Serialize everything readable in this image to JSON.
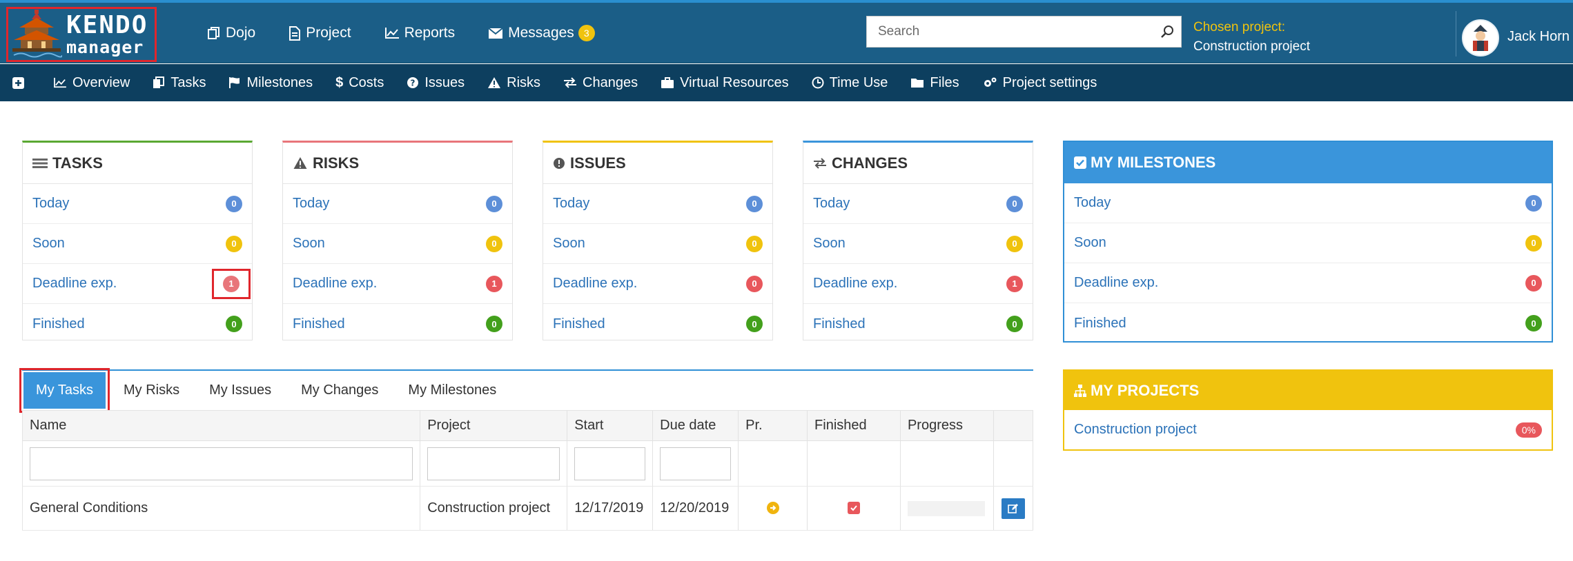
{
  "logo": {
    "line1": "KENDO",
    "line2": "manager"
  },
  "topnav": {
    "dojo": "Dojo",
    "project": "Project",
    "reports": "Reports",
    "messages": "Messages",
    "messages_count": "3"
  },
  "search": {
    "placeholder": "Search"
  },
  "chosen_project": {
    "label": "Chosen project:",
    "value": "Construction project"
  },
  "user": {
    "name": "Jack Horn"
  },
  "subnav": {
    "overview": "Overview",
    "tasks": "Tasks",
    "milestones": "Milestones",
    "costs": "Costs",
    "issues": "Issues",
    "risks": "Risks",
    "changes": "Changes",
    "virtual_resources": "Virtual Resources",
    "time_use": "Time Use",
    "files": "Files",
    "project_settings": "Project settings"
  },
  "row_labels": {
    "today": "Today",
    "soon": "Soon",
    "deadline": "Deadline exp.",
    "finished": "Finished"
  },
  "cards": {
    "tasks": {
      "title": "TASKS",
      "accent": "#5aa832",
      "today": "0",
      "soon": "0",
      "deadline": "1",
      "finished": "0"
    },
    "risks": {
      "title": "RISKS",
      "accent": "#e8575c",
      "today": "0",
      "soon": "0",
      "deadline": "1",
      "finished": "0"
    },
    "issues": {
      "title": "ISSUES",
      "accent": "#f0c30e",
      "today": "0",
      "soon": "0",
      "deadline": "0",
      "finished": "0"
    },
    "changes": {
      "title": "CHANGES",
      "accent": "#3a95db",
      "today": "0",
      "soon": "0",
      "deadline": "1",
      "finished": "0"
    }
  },
  "milestones": {
    "title": "MY MILESTONES",
    "today": "0",
    "soon": "0",
    "deadline": "0",
    "finished": "0"
  },
  "projects": {
    "title": "MY PROJECTS",
    "items": [
      {
        "name": "Construction project",
        "progress": "0%"
      }
    ]
  },
  "tabs": [
    "My Tasks",
    "My Risks",
    "My Issues",
    "My Changes",
    "My Milestones"
  ],
  "grid": {
    "headers": [
      "Name",
      "Project",
      "Start",
      "Due date",
      "Pr.",
      "Finished",
      "Progress"
    ],
    "rows": [
      {
        "name": "General Conditions",
        "project": "Construction project",
        "start": "12/17/2019",
        "due": "12/20/2019",
        "progress": 0
      }
    ]
  },
  "colors": {
    "topbar": "#1b5e87",
    "subnav": "#0d3f5f",
    "blue": "#3a95db",
    "yellow": "#f0c30e",
    "red": "#e8575c",
    "green": "#43a01c",
    "link": "#2b72b8"
  }
}
